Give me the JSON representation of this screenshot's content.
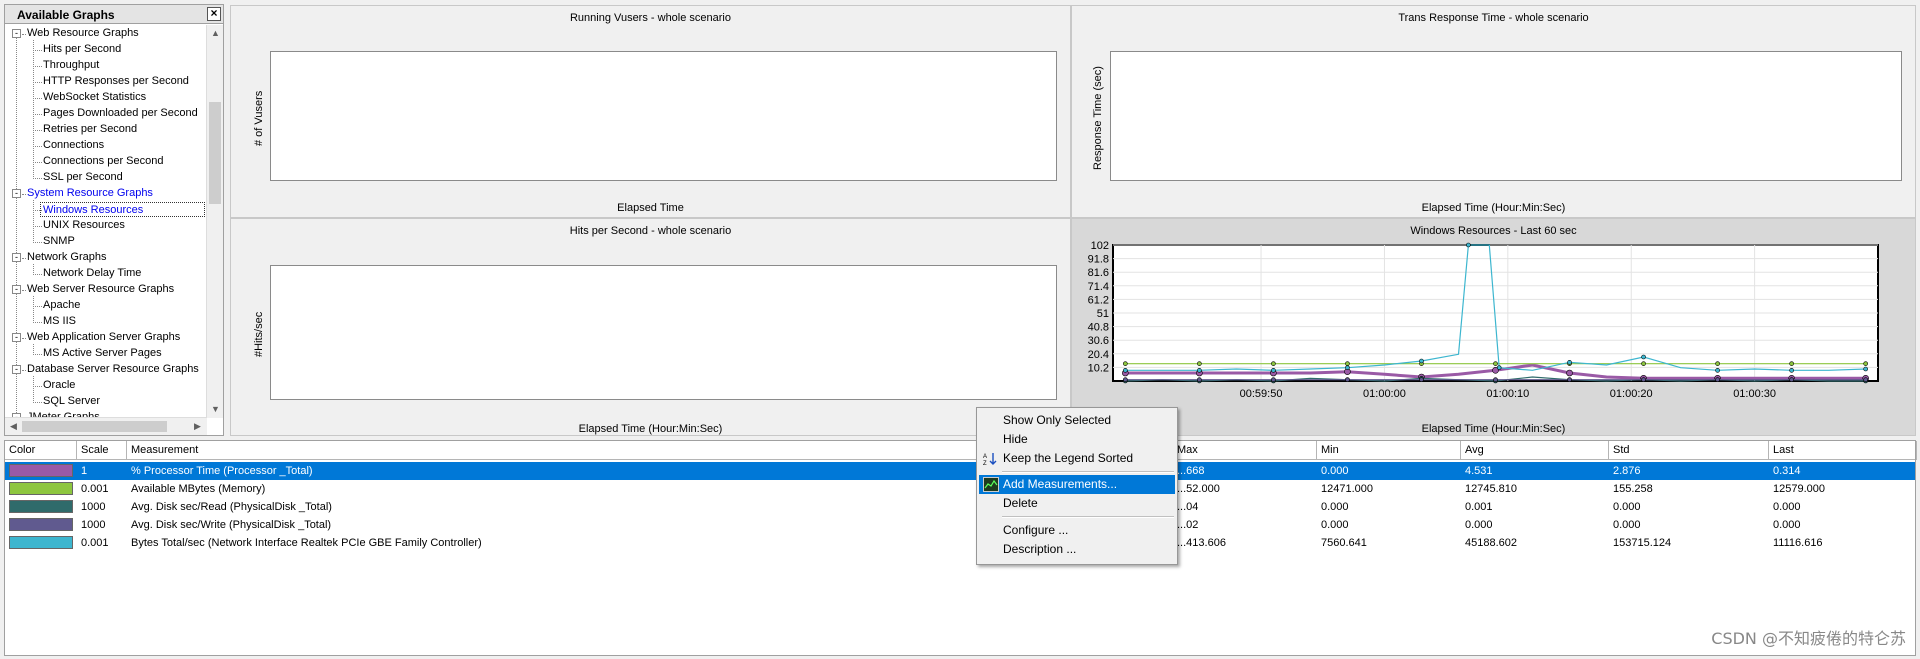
{
  "tree": {
    "title": "Available Graphs",
    "close": "×",
    "items": [
      {
        "label": "Web Resource Graphs",
        "kind": "cat",
        "exp": "-"
      },
      {
        "label": "Hits per Second",
        "kind": "leaf"
      },
      {
        "label": "Throughput",
        "kind": "leaf"
      },
      {
        "label": "HTTP Responses per Second",
        "kind": "leaf"
      },
      {
        "label": "WebSocket Statistics",
        "kind": "leaf"
      },
      {
        "label": "Pages Downloaded per Second",
        "kind": "leaf"
      },
      {
        "label": "Retries per Second",
        "kind": "leaf"
      },
      {
        "label": "Connections",
        "kind": "leaf"
      },
      {
        "label": "Connections per Second",
        "kind": "leaf"
      },
      {
        "label": "SSL per Second",
        "kind": "leaf"
      },
      {
        "label": "System Resource Graphs",
        "kind": "cat",
        "exp": "-",
        "style": "blue"
      },
      {
        "label": "Windows Resources",
        "kind": "leaf",
        "style": "selected"
      },
      {
        "label": "UNIX Resources",
        "kind": "leaf"
      },
      {
        "label": "SNMP",
        "kind": "leaf"
      },
      {
        "label": "Network Graphs",
        "kind": "cat",
        "exp": "-"
      },
      {
        "label": "Network Delay Time",
        "kind": "leaf"
      },
      {
        "label": "Web Server Resource Graphs",
        "kind": "cat",
        "exp": "-"
      },
      {
        "label": "Apache",
        "kind": "leaf"
      },
      {
        "label": "MS IIS",
        "kind": "leaf"
      },
      {
        "label": "Web Application Server Graphs",
        "kind": "cat",
        "exp": "-"
      },
      {
        "label": "MS Active Server Pages",
        "kind": "leaf"
      },
      {
        "label": "Database Server Resource Graphs",
        "kind": "cat",
        "exp": "-"
      },
      {
        "label": "Oracle",
        "kind": "leaf"
      },
      {
        "label": "SQL Server",
        "kind": "leaf"
      },
      {
        "label": "JMeter Graphs",
        "kind": "cat",
        "exp": "-"
      }
    ]
  },
  "graphs": {
    "running_vusers": {
      "title": "Running Vusers - whole scenario",
      "ylabel": "# of Vusers",
      "xlabel": "Elapsed Time"
    },
    "trans_response": {
      "title": "Trans Response Time - whole scenario",
      "ylabel": "Response Time (sec)",
      "xlabel": "Elapsed Time (Hour:Min:Sec)"
    },
    "hits_per_second": {
      "title": "Hits per Second - whole scenario",
      "ylabel": "#Hits/sec",
      "xlabel": "Elapsed Time (Hour:Min:Sec)"
    },
    "windows_resources": {
      "title": "Windows Resources - Last 60 sec",
      "xlabel": "Elapsed Time (Hour:Min:Sec)"
    }
  },
  "chart_data": {
    "type": "line",
    "title": "Windows Resources - Last 60 sec",
    "xlabel": "Elapsed Time (Hour:Min:Sec)",
    "ylabel": "",
    "ylim": [
      0,
      102
    ],
    "yticks": [
      "102",
      "91.8",
      "81.6",
      "71.4",
      "61.2",
      "51",
      "40.8",
      "30.6",
      "20.4",
      "10.2"
    ],
    "xticks": [
      "00:59:50",
      "01:00:00",
      "01:00:10",
      "01:00:20",
      "01:00:30"
    ],
    "xlim": [
      -22,
      40
    ],
    "tick_positions": [
      -10,
      0,
      10,
      20,
      30
    ],
    "grid": true,
    "series": [
      {
        "color": "#9a5aa6",
        "x": [
          -21,
          -18,
          -15,
          -12,
          -9,
          -6,
          -3,
          0,
          3,
          6,
          9,
          12,
          15,
          18,
          21,
          24,
          27,
          30,
          33,
          36,
          39
        ],
        "y": [
          6,
          6,
          6,
          6,
          6,
          6,
          7,
          5,
          3,
          5,
          8,
          12,
          6,
          3,
          2,
          2,
          2,
          2,
          2,
          2,
          2
        ]
      },
      {
        "color": "#8dc63f",
        "x": [
          -21,
          -18,
          -15,
          -12,
          -9,
          -6,
          -3,
          0,
          3,
          6,
          9,
          12,
          15,
          18,
          21,
          24,
          27,
          30,
          33,
          36,
          39
        ],
        "y": [
          13,
          13,
          13,
          13,
          13,
          13,
          13,
          13,
          13,
          13,
          13,
          13,
          13,
          13,
          13,
          13,
          13,
          13,
          13,
          13,
          13
        ]
      },
      {
        "color": "#2f6b6b",
        "x": [
          -21,
          -18,
          -15,
          -12,
          -9,
          -6,
          -3,
          0,
          3,
          6,
          9,
          12,
          15,
          18,
          21,
          24,
          27,
          30,
          33,
          36,
          39
        ],
        "y": [
          0,
          1,
          0,
          1,
          0,
          2,
          1,
          0,
          2,
          1,
          0,
          3,
          1,
          0,
          1,
          0,
          1,
          0,
          1,
          0,
          0
        ]
      },
      {
        "color": "#605a8f",
        "x": [
          -21,
          -18,
          -15,
          -12,
          -9,
          -6,
          -3,
          0,
          3,
          6,
          9,
          12,
          15,
          18,
          21,
          24,
          27,
          30,
          33,
          36,
          39
        ],
        "y": [
          1,
          1,
          1,
          1,
          1,
          1,
          1,
          1,
          1,
          1,
          1,
          1,
          1,
          1,
          1,
          1,
          1,
          1,
          1,
          1,
          1
        ]
      },
      {
        "color": "#3db6cf",
        "x": [
          -21,
          -18,
          -15,
          -12,
          -9,
          -6,
          -3,
          0,
          3,
          6,
          6.8,
          8.5,
          9.3,
          12,
          15,
          18,
          21,
          24,
          27,
          30,
          33,
          36,
          39
        ],
        "y": [
          8,
          8,
          8,
          9,
          8,
          9,
          10,
          12,
          15,
          20,
          102,
          102,
          10,
          8,
          14,
          12,
          18,
          10,
          8,
          9,
          8,
          8,
          9
        ]
      }
    ]
  },
  "legend": {
    "columns": [
      "Color",
      "Scale",
      "Measurement",
      "Max",
      "Min",
      "Avg",
      "Std",
      "Last"
    ],
    "rows": [
      {
        "color": "#9a5aa6",
        "scale": "1",
        "measurement": "% Processor Time (Processor _Total)",
        "max": "...668",
        "min": "0.000",
        "avg": "4.531",
        "std": "2.876",
        "last": "0.314"
      },
      {
        "color": "#8dc63f",
        "scale": "0.001",
        "measurement": "Available MBytes (Memory)",
        "max": "...52.000",
        "min": "12471.000",
        "avg": "12745.810",
        "std": "155.258",
        "last": "12579.000"
      },
      {
        "color": "#2f6b6b",
        "scale": "1000",
        "measurement": "Avg. Disk sec/Read (PhysicalDisk _Total)",
        "max": "...04",
        "min": "0.000",
        "avg": "0.001",
        "std": "0.000",
        "last": "0.000"
      },
      {
        "color": "#605a8f",
        "scale": "1000",
        "measurement": "Avg. Disk sec/Write (PhysicalDisk _Total)",
        "max": "...02",
        "min": "0.000",
        "avg": "0.000",
        "std": "0.000",
        "last": "0.000"
      },
      {
        "color": "#3db6cf",
        "scale": "0.001",
        "measurement": "Bytes Total/sec (Network Interface Realtek PCIe GBE Family Controller)",
        "max": "...413.606",
        "min": "7560.641",
        "avg": "45188.602",
        "std": "153715.124",
        "last": "11116.616"
      }
    ]
  },
  "context_menu": {
    "items": [
      "Show Only Selected",
      "Hide",
      "Keep the Legend Sorted",
      "Add Measurements...",
      "Delete",
      "Configure ...",
      "Description ..."
    ]
  },
  "watermark": "CSDN @不知疲倦的特仑苏",
  "colors": {
    "selection": "#0078d7"
  }
}
